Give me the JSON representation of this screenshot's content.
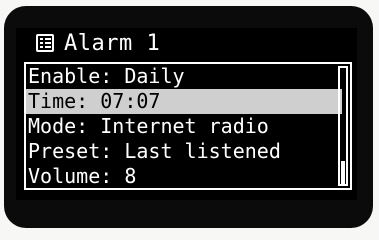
{
  "header": {
    "icon": "list-menu-icon",
    "title": "Alarm 1"
  },
  "menu": {
    "items": [
      {
        "label": "Enable: Daily",
        "selected": false
      },
      {
        "label": "Time: 07:07",
        "selected": true
      },
      {
        "label": "Mode: Internet radio",
        "selected": false
      },
      {
        "label": "Preset: Last listened",
        "selected": false
      },
      {
        "label": "Volume: 8",
        "selected": false
      }
    ]
  },
  "scrollbar": {
    "position_fraction": 0.8,
    "visible_fraction": 0.2
  },
  "colors": {
    "background": "#000000",
    "text": "#ffffff",
    "highlight_bg": "#cfcfcf",
    "highlight_text": "#000000"
  }
}
